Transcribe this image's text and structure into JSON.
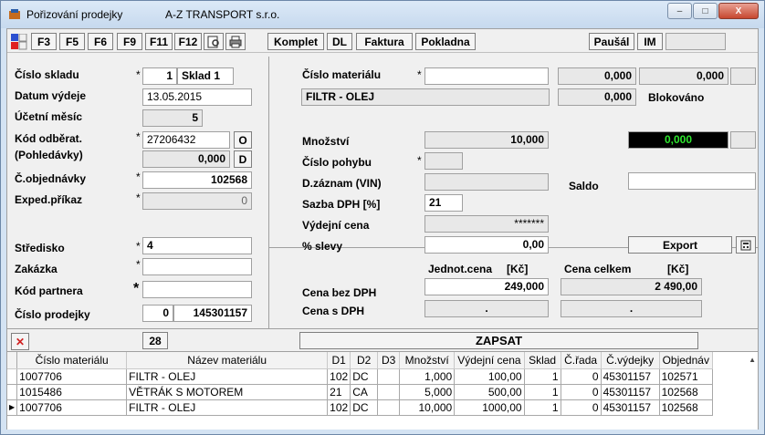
{
  "window": {
    "title": "Pořizování prodejky",
    "company": "A-Z TRANSPORT s.r.o.",
    "buttons": [
      "–",
      "□",
      "X"
    ]
  },
  "toolbar": {
    "buttons": [
      "F3",
      "F5",
      "F6",
      "F9",
      "F11",
      "F12"
    ],
    "komplet": "Komplet",
    "dl": "DL",
    "faktura": "Faktura",
    "pokladna": "Pokladna",
    "pausal": "Paušál",
    "im": "IM"
  },
  "left": {
    "cislo_skladu_label": "Číslo skladu",
    "cislo_skladu_num": "1",
    "cislo_skladu_name": "Sklad 1",
    "datum_label": "Datum výdeje",
    "datum": "13.05.2015",
    "ucetni_label": "Účetní měsíc",
    "ucetni": "5",
    "kod_odb_label": "Kód odběrat.",
    "kod_odb": "27206432",
    "kod_odb_btn": "O",
    "pohledavky_label": "(Pohledávky)",
    "pohledavky": "0,000",
    "pohledavky_btn": "D",
    "objednavky_label": "Č.objednávky",
    "objednavky": "102568",
    "exped_label": "Exped.příkaz",
    "exped": "0",
    "stredisko_label": "Středisko",
    "stredisko": "4",
    "zakazka_label": "Zakázka",
    "zakazka": "",
    "partner_label": "Kód partnera",
    "partner": "",
    "prodejka_label": "Číslo prodejky",
    "prodejka_num": "0",
    "prodejka": "145301157"
  },
  "right": {
    "cislo_mat_label": "Číslo materiálu",
    "cislo_mat": "",
    "val1": "0,000",
    "val2": "0,000",
    "nazev": "FILTR - OLEJ",
    "val3": "0,000",
    "blokovano": "Blokováno",
    "mnozstvi_label": "Množství",
    "mnozstvi": "10,000",
    "black_val": "0,000",
    "pohyb_label": "Číslo pohybu",
    "vin_label": "D.záznam (VIN)",
    "saldo_label": "Saldo",
    "dph_label": "Sazba DPH [%]",
    "dph": "21",
    "vydejni_label": "Výdejní cena",
    "vydejni": "*******",
    "sleva_label": "% slevy",
    "sleva": "0,00",
    "export": "Export",
    "jednot_label": "Jednot.cena",
    "kc1": "[Kč]",
    "celkem_label": "Cena celkem",
    "kc2": "[Kč]",
    "bez_dph_label": "Cena bez DPH",
    "bez_dph": "249,000",
    "celkem": "2 490,00",
    "s_dph_label": "Cena s DPH",
    "s_dph": ".",
    "s_dph_celkem": "."
  },
  "action": {
    "count": "28",
    "zapsat": "ZAPSAT"
  },
  "table": {
    "headers": [
      "Číslo materiálu",
      "Název materiálu",
      "D1",
      "D2",
      "D3",
      "Množství",
      "Výdejní cena",
      "Sklad",
      "Č.řada",
      "Č.výdejky",
      "Objednáv"
    ],
    "rows": [
      [
        "1007706",
        "FILTR - OLEJ",
        "102",
        "DC",
        "",
        "1,000",
        "100,00",
        "1",
        "0",
        "45301157",
        "102571"
      ],
      [
        "1015486",
        "VĚTRÁK S MOTOREM",
        "21",
        "CA",
        "",
        "5,000",
        "500,00",
        "1",
        "0",
        "45301157",
        "102568"
      ],
      [
        "1007706",
        "FILTR - OLEJ",
        "102",
        "DC",
        "",
        "10,000",
        "1000,00",
        "1",
        "0",
        "45301157",
        "102568"
      ]
    ]
  }
}
